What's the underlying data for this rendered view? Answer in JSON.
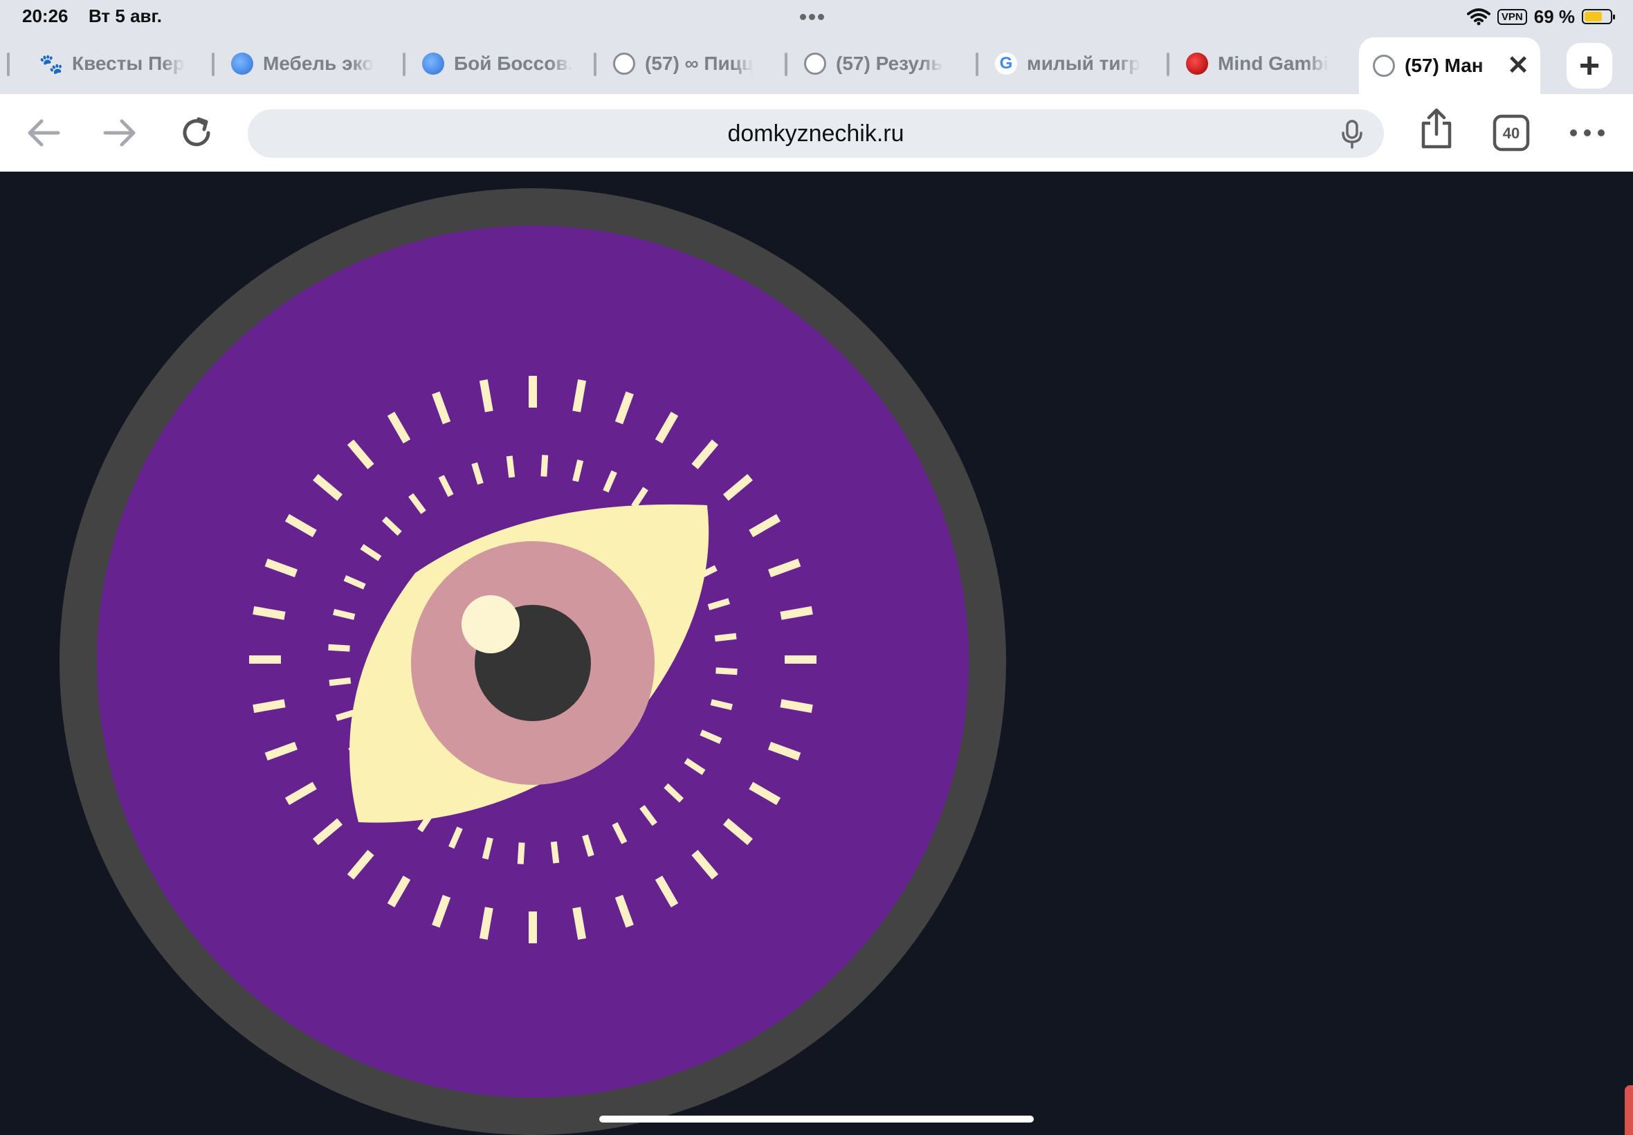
{
  "status_bar": {
    "time": "20:26",
    "date": "Вт 5 авг.",
    "vpn": "VPN",
    "battery_percent": "69 %",
    "battery_level": 0.69
  },
  "tabs": [
    {
      "title": "Квесты Пер",
      "icon": "paw-icon"
    },
    {
      "title": "Мебель эко",
      "icon": "site-icon"
    },
    {
      "title": "Бой Боссов.",
      "icon": "site-icon"
    },
    {
      "title": "(57) ∞ Пицц",
      "icon": "globe-icon"
    },
    {
      "title": "(57) Резуль",
      "icon": "globe-icon"
    },
    {
      "title": "милый тигр",
      "icon": "google-icon"
    },
    {
      "title": "Mind Gambi",
      "icon": "red-site-icon"
    }
  ],
  "active_tab": {
    "title": "(57) Ман",
    "icon": "globe-icon"
  },
  "toolbar": {
    "url": "domkyznechik.ru",
    "tab_count": "40"
  },
  "artwork": {
    "colors": {
      "ring": "#434343",
      "disc": "#66228f",
      "rays": "#fbf1c5",
      "sclera": "#fbf1b3",
      "iris": "#d0979e",
      "pupil": "#353535",
      "highlight": "#fdf5d2"
    }
  }
}
